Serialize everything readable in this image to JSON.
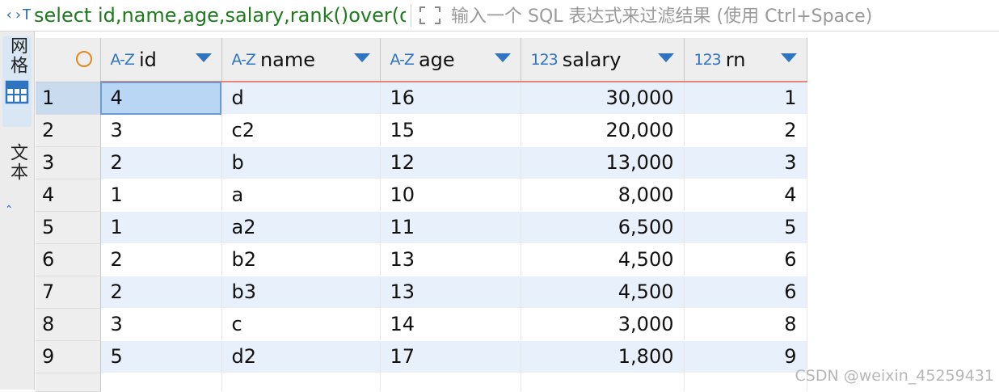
{
  "topbar": {
    "sql_icon": "‹›T",
    "sql_text": "select id,name,age,salary,rank()over(order by salary desc) rn from t",
    "expand_icon": "expand-icon",
    "filter_placeholder": "输入一个 SQL 表达式来过滤结果 (使用 Ctrl+Space)"
  },
  "sidebar": {
    "tabs": [
      {
        "label": "网格",
        "icon": "grid-icon",
        "active": true
      },
      {
        "label": "文本",
        "icon": "text-icon",
        "active": false
      }
    ]
  },
  "grid": {
    "columns": [
      {
        "type": "A-Z",
        "name": "id"
      },
      {
        "type": "A-Z",
        "name": "name"
      },
      {
        "type": "A-Z",
        "name": "age"
      },
      {
        "type": "123",
        "name": "salary"
      },
      {
        "type": "123",
        "name": "rn"
      }
    ],
    "rows": [
      {
        "num": "1",
        "id": "4",
        "name": "d",
        "age": "16",
        "salary": "30,000",
        "rn": "1"
      },
      {
        "num": "2",
        "id": "3",
        "name": "c2",
        "age": "15",
        "salary": "20,000",
        "rn": "2"
      },
      {
        "num": "3",
        "id": "2",
        "name": "b",
        "age": "12",
        "salary": "13,000",
        "rn": "3"
      },
      {
        "num": "4",
        "id": "1",
        "name": "a",
        "age": "10",
        "salary": "8,000",
        "rn": "4"
      },
      {
        "num": "5",
        "id": "1",
        "name": "a2",
        "age": "11",
        "salary": "6,500",
        "rn": "5"
      },
      {
        "num": "6",
        "id": "2",
        "name": "b2",
        "age": "13",
        "salary": "4,500",
        "rn": "6"
      },
      {
        "num": "7",
        "id": "2",
        "name": "b3",
        "age": "13",
        "salary": "4,500",
        "rn": "6"
      },
      {
        "num": "8",
        "id": "3",
        "name": "c",
        "age": "14",
        "salary": "3,000",
        "rn": "8"
      },
      {
        "num": "9",
        "id": "5",
        "name": "d2",
        "age": "17",
        "salary": "1,800",
        "rn": "9"
      }
    ]
  },
  "watermark": "CSDN @weixin_45259431",
  "colors": {
    "sql": "#1d7a1d",
    "accent": "#2f74c0",
    "header_underline": "#e4847a",
    "row_alt": "#e7f0fb"
  }
}
